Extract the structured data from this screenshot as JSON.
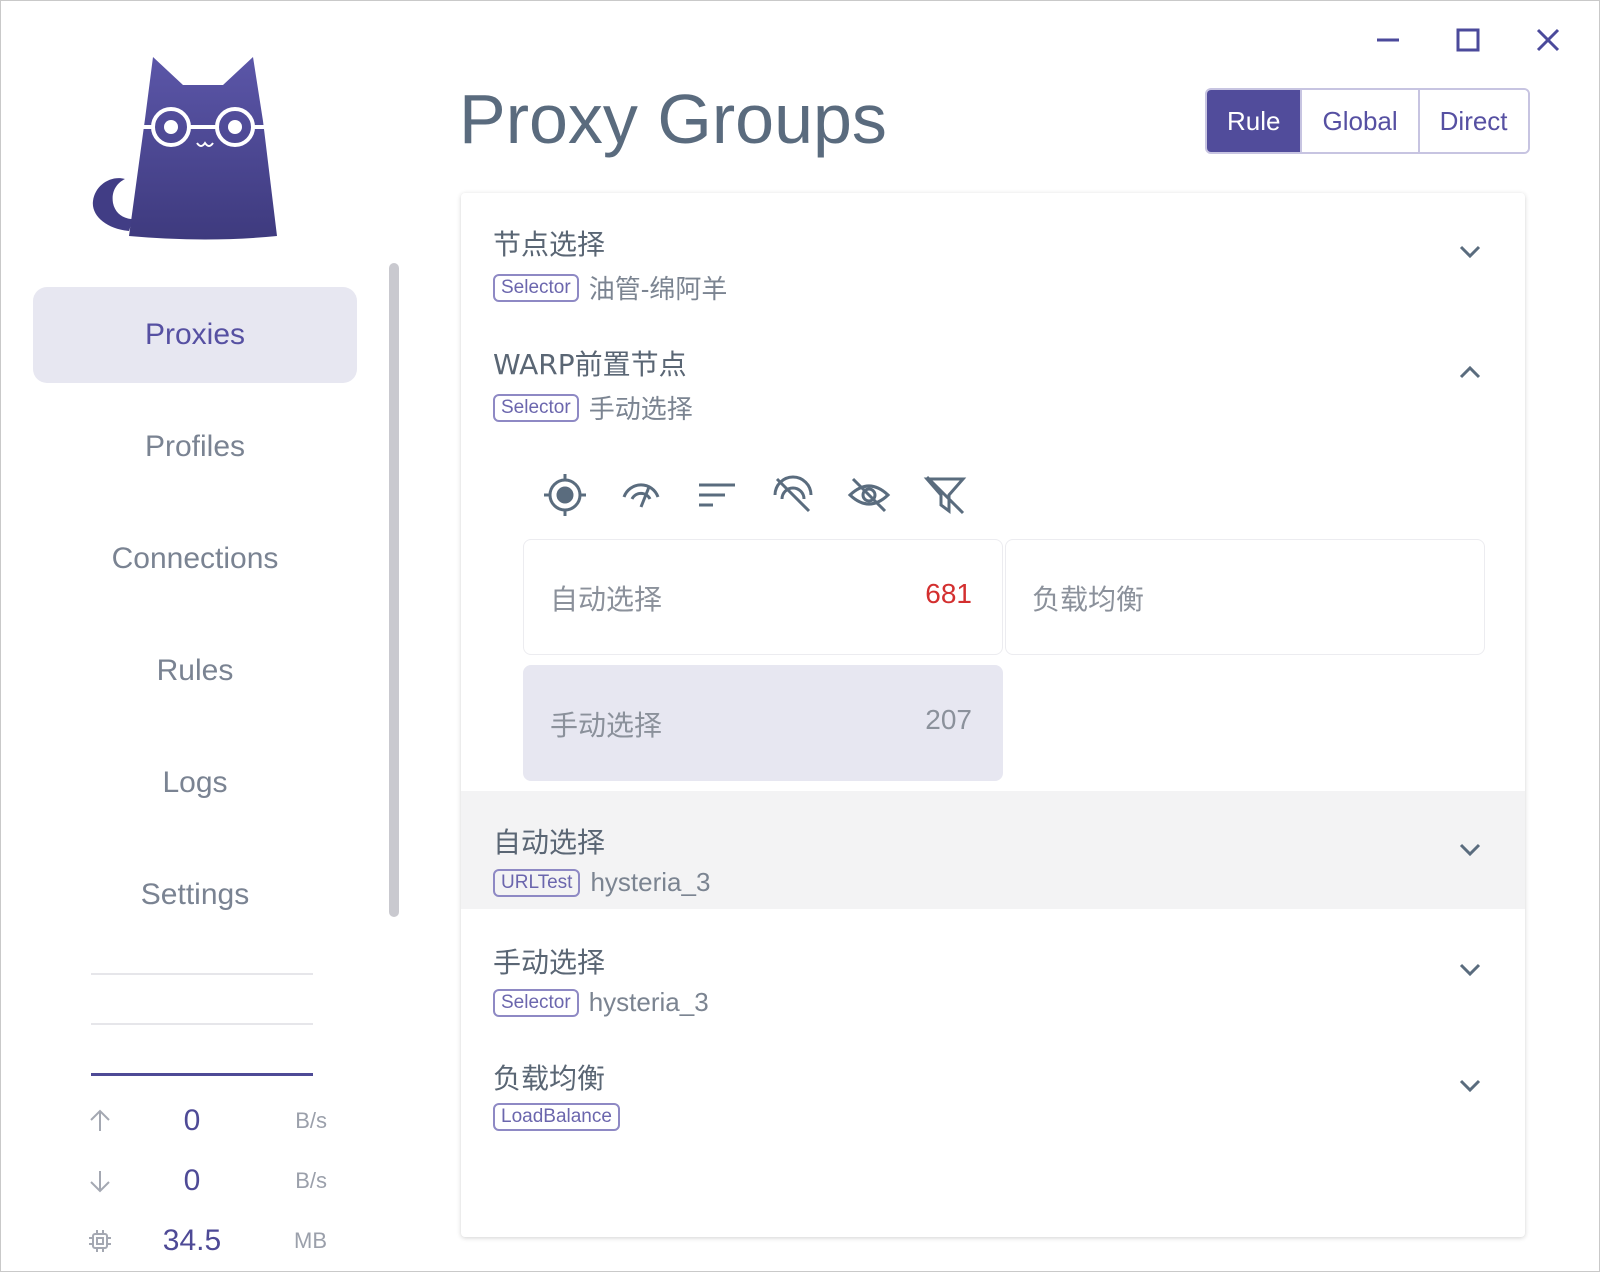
{
  "window": {
    "controls": [
      "minimize-icon",
      "maximize-icon",
      "close-icon"
    ]
  },
  "sidebar": {
    "items": [
      {
        "label": "Proxies",
        "active": true
      },
      {
        "label": "Profiles",
        "active": false
      },
      {
        "label": "Connections",
        "active": false
      },
      {
        "label": "Rules",
        "active": false
      },
      {
        "label": "Logs",
        "active": false
      },
      {
        "label": "Settings",
        "active": false
      }
    ],
    "stats": {
      "upload": {
        "value": "0",
        "unit": "B/s",
        "icon": "arrow-up-icon"
      },
      "download": {
        "value": "0",
        "unit": "B/s",
        "icon": "arrow-down-icon"
      },
      "memory": {
        "value": "34.5",
        "unit": "MB",
        "icon": "memory-chip-icon"
      }
    }
  },
  "header": {
    "title": "Proxy Groups",
    "modes": [
      {
        "label": "Rule",
        "active": true
      },
      {
        "label": "Global",
        "active": false
      },
      {
        "label": "Direct",
        "active": false
      }
    ]
  },
  "groups": [
    {
      "name": "节点选择",
      "type": "Selector",
      "now": "油管-绵阿羊",
      "expanded": false
    },
    {
      "name": "WARP前置节点",
      "type": "Selector",
      "now": "手动选择",
      "expanded": true,
      "tools": [
        "locate-icon",
        "speed-test-icon",
        "sort-icon",
        "filter-unavailable-icon",
        "hide-icon",
        "clear-filter-icon"
      ],
      "proxies": [
        {
          "name": "自动选择",
          "delay": "681",
          "delay_color": "#d32f2f",
          "selected": false
        },
        {
          "name": "负载均衡",
          "delay": "",
          "selected": false
        },
        {
          "name": "手动选择",
          "delay": "207",
          "delay_color": "#8b919b",
          "selected": true
        }
      ]
    },
    {
      "name": "自动选择",
      "type": "URLTest",
      "now": "hysteria_3",
      "expanded": false
    },
    {
      "name": "手动选择",
      "type": "Selector",
      "now": "hysteria_3",
      "expanded": false
    },
    {
      "name": "负载均衡",
      "type": "LoadBalance",
      "now": "",
      "expanded": false
    }
  ],
  "colors": {
    "accent": "#514c9b",
    "delay_slow": "#d32f2f"
  }
}
